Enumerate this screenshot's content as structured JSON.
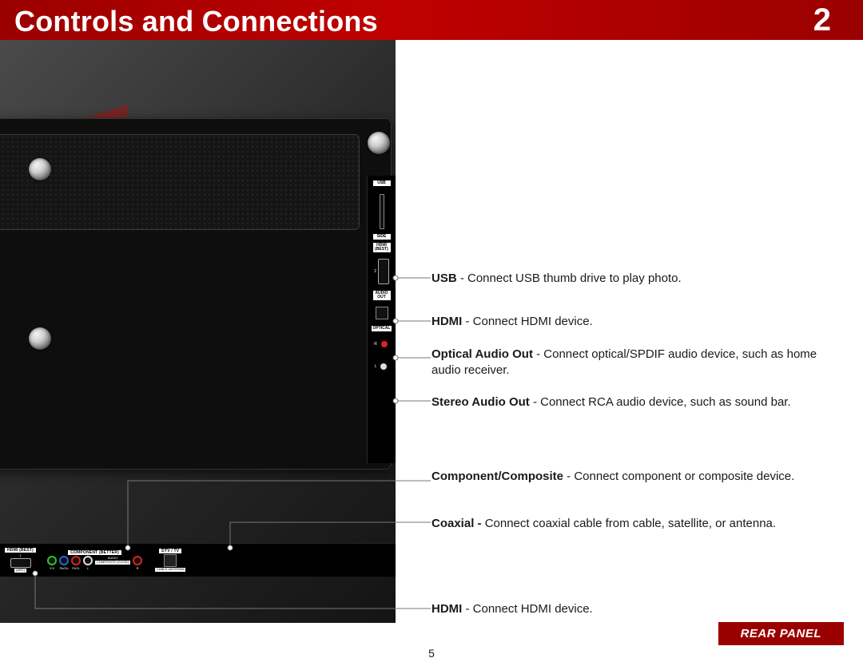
{
  "header": {
    "title": "Controls and Connections",
    "chapter": "2"
  },
  "side_ports": {
    "usb_label": "USB",
    "side_label": "SIDE",
    "hdmi_label": "HDMI",
    "hdmi_sub": "(BEST)",
    "hdmi_num": "2",
    "audio_label": "AUDIO",
    "audio_sub": "OUT",
    "optical_label": "OPTICAL",
    "rca_r": "R",
    "rca_l": "L"
  },
  "bottom_ports": {
    "hdmi_title": "HDMI (BEST)",
    "hdmi_num": "1",
    "hdmi_arc": "(ARC)",
    "component_title": "COMPONENT (BETTER)",
    "composite_title": "COMPOSITE (GOOD)",
    "yv": "Y/V",
    "pbcb": "Pb/Cb",
    "prcr": "Pr/Cr",
    "l": "L",
    "audio": "AUDIO",
    "r": "R",
    "dtv_title": "DTV / TV",
    "cable": "CABLE /ANTENNA"
  },
  "descs": {
    "usb": {
      "bold": "USB",
      "text": " - Connect USB thumb drive to play photo."
    },
    "hdmi_side": {
      "bold": "HDMI",
      "text": " - Connect HDMI device."
    },
    "optical": {
      "bold": "Optical Audio Out",
      "text": " - Connect optical/SPDIF audio device, such as home audio receiver."
    },
    "stereo": {
      "bold": "Stereo Audio Out",
      "text": " - Connect RCA audio device, such as sound bar."
    },
    "component": {
      "bold": "Component/Composite",
      "text": " - Connect component or composite device."
    },
    "coax": {
      "bold": "Coaxial - ",
      "text": "Connect coaxial cable from cable, satellite, or antenna."
    },
    "hdmi_bottom": {
      "bold": "HDMI",
      "text": " - Connect HDMI device."
    }
  },
  "footer": {
    "rear_panel": "REAR PANEL",
    "page_number": "5"
  }
}
